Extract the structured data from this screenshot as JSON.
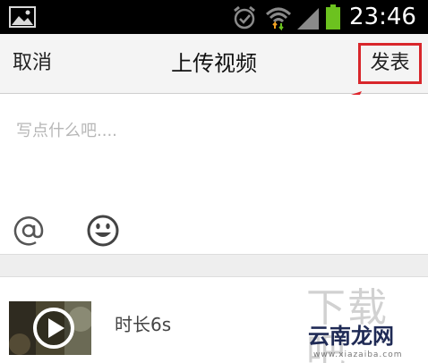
{
  "status_bar": {
    "time": "23:46",
    "icons": [
      "gallery-icon",
      "alarm-icon",
      "wifi-icon",
      "signal-icon",
      "battery-icon"
    ],
    "battery_color": "#6cc21f"
  },
  "nav": {
    "cancel_label": "取消",
    "title": "上传视频",
    "publish_label": "发表",
    "highlight_color": "#d8262b"
  },
  "compose": {
    "placeholder": "写点什么吧....",
    "value": "",
    "tools": [
      "at-icon",
      "emoji-icon"
    ]
  },
  "video": {
    "duration_label": "时长6s"
  },
  "watermark": {
    "big": "下载吧",
    "cn": "云南龙网",
    "url": "www.xiazaiba.com"
  }
}
